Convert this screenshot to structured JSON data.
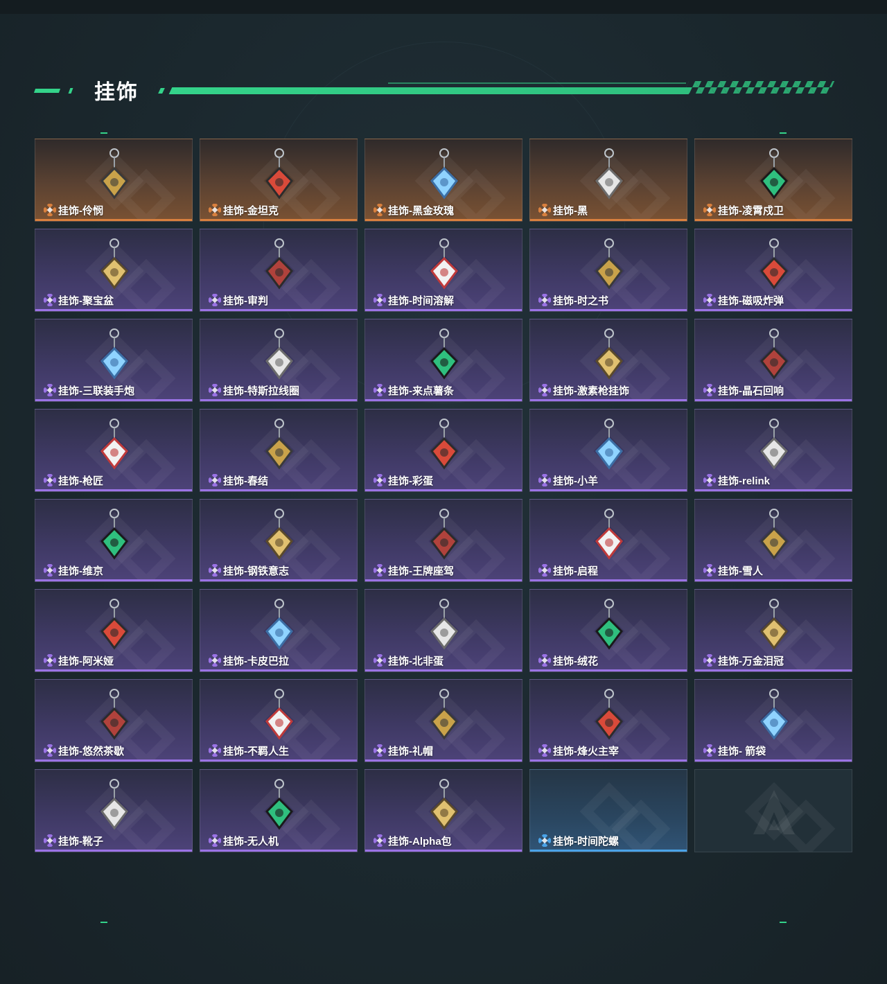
{
  "header": {
    "title": "挂饰"
  },
  "colors": {
    "accent": "#34d38a",
    "orange_rarity": "#d9803e",
    "purple_rarity": "#9b73e6",
    "blue_rarity": "#4aa3e8"
  },
  "items": [
    {
      "label": "挂饰-伶悯",
      "rarity": "orange",
      "icon": "kunai-pendant-icon"
    },
    {
      "label": "挂饰-金坦克",
      "rarity": "orange",
      "icon": "gold-tank-pendant-icon"
    },
    {
      "label": "挂饰-黑金玫瑰",
      "rarity": "orange",
      "icon": "black-gold-rose-pendant-icon"
    },
    {
      "label": "挂饰-黑",
      "rarity": "orange",
      "icon": "black-tag-pendant-icon"
    },
    {
      "label": "挂饰-凌霄戍卫",
      "rarity": "orange",
      "icon": "guardian-bird-pendant-icon"
    },
    {
      "label": "挂饰-聚宝盆",
      "rarity": "purple",
      "icon": "treasure-bowl-pendant-icon"
    },
    {
      "label": "挂饰-审判",
      "rarity": "purple",
      "icon": "judgement-card-pendant-icon"
    },
    {
      "label": "挂饰-时间溶解",
      "rarity": "purple",
      "icon": "melting-clock-pendant-icon"
    },
    {
      "label": "挂饰-时之书",
      "rarity": "purple",
      "icon": "time-book-pendant-icon"
    },
    {
      "label": "挂饰-磁吸炸弹",
      "rarity": "purple",
      "icon": "magnetic-bomb-pendant-icon"
    },
    {
      "label": "挂饰-三联装手炮",
      "rarity": "purple",
      "icon": "hand-cannon-pendant-icon"
    },
    {
      "label": "挂饰-特斯拉线圈",
      "rarity": "purple",
      "icon": "tesla-coil-pendant-icon"
    },
    {
      "label": "挂饰-来点薯条",
      "rarity": "purple",
      "icon": "fries-pendant-icon"
    },
    {
      "label": "挂饰-激素枪挂饰",
      "rarity": "purple",
      "icon": "stim-gun-pendant-icon"
    },
    {
      "label": "挂饰-晶石回响",
      "rarity": "purple",
      "icon": "crystal-pendant-icon"
    },
    {
      "label": "挂饰-枪匠",
      "rarity": "purple",
      "icon": "gunsmith-pendant-icon"
    },
    {
      "label": "挂饰-春结",
      "rarity": "purple",
      "icon": "chinese-knot-pendant-icon"
    },
    {
      "label": "挂饰-彩蛋",
      "rarity": "purple",
      "icon": "easter-egg-pendant-icon"
    },
    {
      "label": "挂饰-小羊",
      "rarity": "purple",
      "icon": "lamb-pendant-icon"
    },
    {
      "label": "挂饰-relink",
      "rarity": "purple",
      "icon": "relink-pendant-icon"
    },
    {
      "label": "挂饰-维京",
      "rarity": "purple",
      "icon": "viking-anchor-pendant-icon"
    },
    {
      "label": "挂饰-钢铁意志",
      "rarity": "purple",
      "icon": "dog-tag-pendant-icon"
    },
    {
      "label": "挂饰-王牌座驾",
      "rarity": "purple",
      "icon": "jet-plane-pendant-icon"
    },
    {
      "label": "挂饰-启程",
      "rarity": "purple",
      "icon": "departure-medal-pendant-icon"
    },
    {
      "label": "挂饰-雪人",
      "rarity": "purple",
      "icon": "snowman-pendant-icon"
    },
    {
      "label": "挂饰-阿米娅",
      "rarity": "purple",
      "icon": "amiya-pendant-icon"
    },
    {
      "label": "挂饰-卡皮巴拉",
      "rarity": "purple",
      "icon": "capybara-pendant-icon"
    },
    {
      "label": "挂饰-北非蛋",
      "rarity": "purple",
      "icon": "shakshuka-pendant-icon"
    },
    {
      "label": "挂饰-绒花",
      "rarity": "purple",
      "icon": "velvet-flower-pendant-icon"
    },
    {
      "label": "挂饰-万金泪冠",
      "rarity": "purple",
      "icon": "golden-crown-pendant-icon"
    },
    {
      "label": "挂饰-悠然茶歇",
      "rarity": "purple",
      "icon": "cupcake-pendant-icon"
    },
    {
      "label": "挂饰-不羁人生",
      "rarity": "purple",
      "icon": "sneaker-pendant-icon"
    },
    {
      "label": "挂饰-礼帽",
      "rarity": "purple",
      "icon": "fedora-hat-pendant-icon"
    },
    {
      "label": "挂饰-烽火主宰",
      "rarity": "purple",
      "icon": "graffiti-container-pendant-icon"
    },
    {
      "label": "挂饰- 箭袋",
      "rarity": "purple",
      "icon": "quiver-pendant-icon"
    },
    {
      "label": "挂饰-靴子",
      "rarity": "purple",
      "icon": "boot-pendant-icon"
    },
    {
      "label": "挂饰-无人机",
      "rarity": "purple",
      "icon": "drone-pendant-icon"
    },
    {
      "label": "挂饰-Alpha包",
      "rarity": "purple",
      "icon": "alpha-bag-pendant-icon"
    },
    {
      "label": "挂饰-时间陀螺",
      "rarity": "blue",
      "icon": ""
    },
    {
      "label": "",
      "rarity": "empty",
      "icon": "game-logo-icon"
    }
  ]
}
